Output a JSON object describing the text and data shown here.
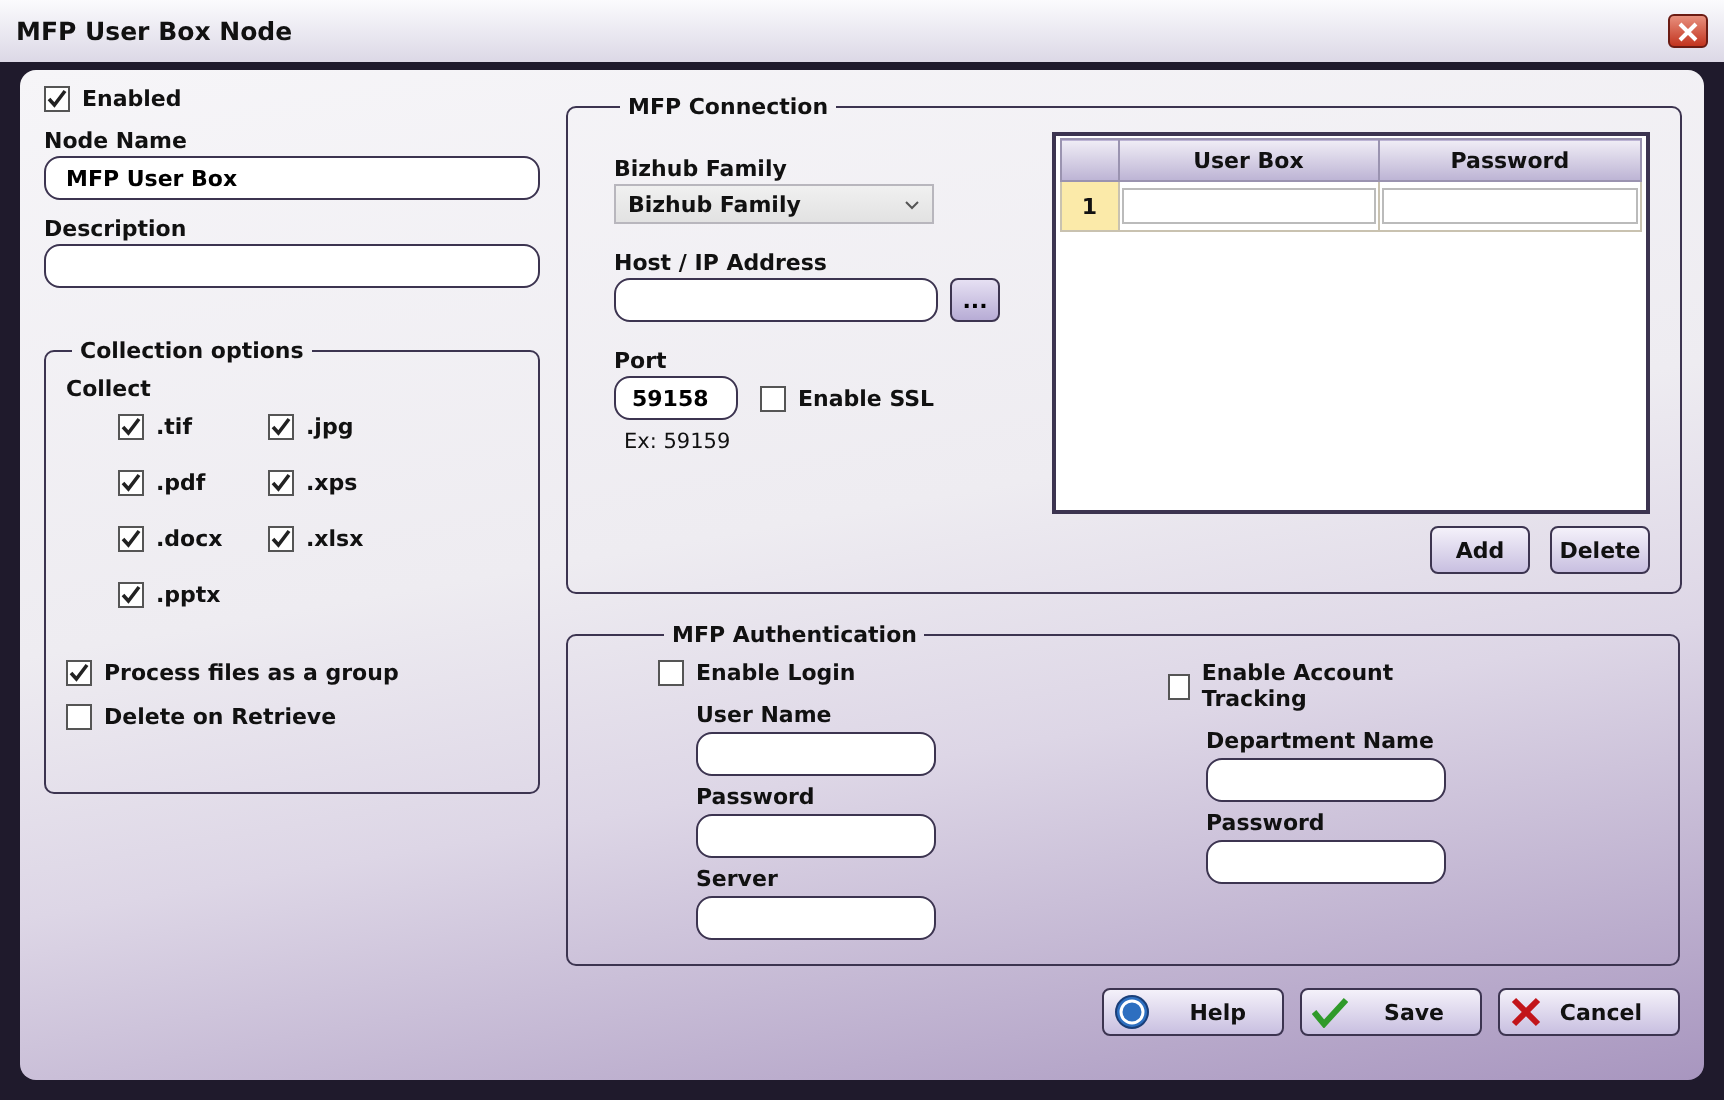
{
  "window": {
    "title": "MFP User Box Node"
  },
  "enabled": {
    "label": "Enabled",
    "checked": true
  },
  "node_name": {
    "label": "Node Name",
    "value": "MFP User Box"
  },
  "description": {
    "label": "Description"
  },
  "collection_options": {
    "title": "Collection options",
    "collect_label": "Collect",
    "file_types": [
      {
        "label": ".tif",
        "checked": true
      },
      {
        "label": ".jpg",
        "checked": true
      },
      {
        "label": ".pdf",
        "checked": true
      },
      {
        "label": ".xps",
        "checked": true
      },
      {
        "label": ".docx",
        "checked": true
      },
      {
        "label": ".xlsx",
        "checked": true
      },
      {
        "label": ".pptx",
        "checked": true
      }
    ],
    "options": [
      {
        "label": "Process files as a group",
        "checked": true
      },
      {
        "label": "Delete on Retrieve",
        "checked": false
      }
    ]
  },
  "mfp_connection": {
    "title": "MFP Connection",
    "bizhub_family": {
      "label": "Bizhub Family",
      "value": "Bizhub Family"
    },
    "host": {
      "label": "Host / IP Address",
      "browse_button": "..."
    },
    "port": {
      "label": "Port",
      "value": "59158",
      "hint": "Ex: 59159"
    },
    "enable_ssl": {
      "label": "Enable SSL",
      "checked": false
    },
    "table": {
      "columns": [
        "User Box",
        "Password"
      ],
      "rows": [
        {
          "number": "1",
          "selected": true
        }
      ]
    },
    "buttons": [
      "Add",
      "Delete"
    ]
  },
  "mfp_authentication": {
    "title": "MFP Authentication",
    "groups": [
      {
        "toggle": {
          "label": "Enable Login",
          "checked": false
        },
        "fields": [
          {
            "label": "User Name"
          },
          {
            "label": "Password"
          },
          {
            "label": "Server"
          }
        ]
      },
      {
        "toggle": {
          "label": "Enable Account Tracking",
          "checked": false
        },
        "fields": [
          {
            "label": "Department Name"
          },
          {
            "label": "Password"
          }
        ]
      }
    ]
  },
  "buttons": [
    {
      "kind": "help",
      "label": "Help"
    },
    {
      "kind": "save",
      "label": "Save"
    },
    {
      "kind": "cancel",
      "label": "Cancel"
    }
  ]
}
